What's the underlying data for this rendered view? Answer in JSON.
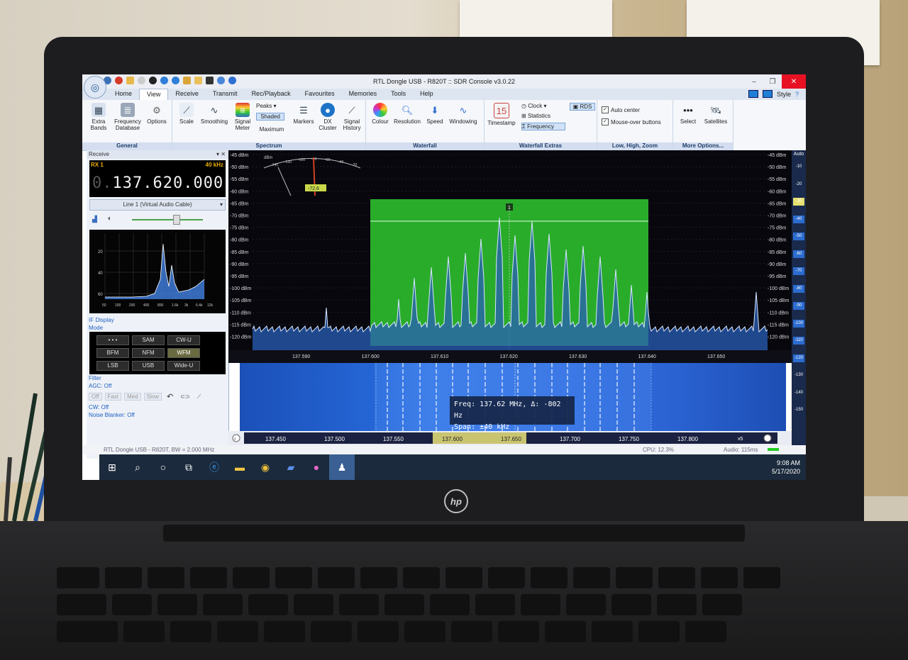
{
  "window": {
    "title": "RTL Dongle USB - R820T :: SDR Console v3.0.22",
    "min": "–",
    "max": "❐",
    "close": "✕"
  },
  "tabs": [
    "Home",
    "View",
    "Receive",
    "Transmit",
    "Rec/Playback",
    "Favourites",
    "Memories",
    "Tools",
    "Help"
  ],
  "active_tab": "View",
  "style_label": "Style",
  "ribbon": {
    "general": {
      "label": "General",
      "extra_bands": "Extra Bands",
      "frequency_database": "Frequency Database",
      "options": "Options"
    },
    "spectrum": {
      "label": "Spectrum",
      "scale": "Scale",
      "smoothing": "Smoothing",
      "signal_meter": "Signal Meter",
      "peaks": "Peaks",
      "shaded": "Shaded",
      "maximum": "Maximum",
      "markers": "Markers",
      "dx_cluster": "DX Cluster",
      "signal_history": "Signal History"
    },
    "waterfall": {
      "label": "Waterfall",
      "colour": "Colour",
      "resolution": "Resolution",
      "speed": "Speed",
      "windowing": "Windowing"
    },
    "waterfall_extras": {
      "label": "Waterfall Extras",
      "timestamp": "Timestamp",
      "clock": "Clock",
      "statistics": "Statistics",
      "frequency": "Frequency",
      "rds": "RDS"
    },
    "lhz": {
      "label": "Low, High, Zoom",
      "auto_center": "Auto center",
      "mouseover": "Mouse-over buttons"
    },
    "more": {
      "label": "More Options...",
      "select": "Select",
      "satellites": "Satellites"
    }
  },
  "receive": {
    "panel_title": "Receive",
    "rx_label": "RX 1",
    "bandwidth": "40 kHz",
    "freq_dim": "0.",
    "freq": "137.620.000",
    "audio_line": "Line 1 (Virtual Audio Cable)",
    "miniplot_yticks": [
      "20",
      "40",
      "60"
    ],
    "miniplot_xticks": [
      "50",
      "100",
      "200",
      "400",
      "800",
      "1.6k",
      "3k",
      "6.4k",
      "12k"
    ],
    "if_display": "IF Display",
    "mode": "Mode",
    "modes": [
      "• • •",
      "SAM",
      "CW-U",
      "BFM",
      "NFM",
      "WFM",
      "LSB",
      "USB",
      "Wide-U"
    ],
    "active_mode": "WFM",
    "filter": "Filter",
    "agc": "AGC: Off",
    "agc_buttons": [
      "Off",
      "Fast",
      "Med",
      "Slow"
    ],
    "cw": "CW: Off",
    "noise_blanker": "Noise Blanker: Off"
  },
  "spectrum": {
    "dbm_left": [
      "-45 dBm",
      "-50 dBm",
      "-55 dBm",
      "-60 dBm",
      "-65 dBm",
      "-70 dBm",
      "-75 dBm",
      "-80 dBm",
      "-85 dBm",
      "-90 dBm",
      "-95 dBm",
      "-100 dBm",
      "-105 dBm",
      "-110 dBm",
      "-115 dBm",
      "-120 dBm"
    ],
    "dbm_right": [
      "-45 dBm",
      "-50 dBm",
      "-55 dBm",
      "-60 dBm",
      "-65 dBm",
      "-70 dBm",
      "-75 dBm",
      "-80 dBm",
      "-85 dBm",
      "-90 dBm",
      "-95 dBm",
      "-100 dBm",
      "-105 dBm",
      "-110 dBm",
      "-115 dBm",
      "-120 dBm"
    ],
    "freq_ticks": [
      "137.590",
      "137.600",
      "137.610",
      "137.620",
      "137.630",
      "137.640",
      "137.650"
    ],
    "meter_unit": "dBm",
    "meter_scale": [
      "-140",
      "-120",
      "-100",
      "-80",
      "-60",
      "-40",
      "-20"
    ],
    "meter_value": "-72.6",
    "marker": "1"
  },
  "waterfall_ticks": [
    "137.450",
    "137.500",
    "137.550",
    "137.600",
    "137.650",
    "137.700",
    "137.750",
    "137.800"
  ],
  "tooltip": {
    "freq": "Freq: 137.62 MHz, Δ: -802 Hz",
    "span": "Span:    ±40 kHz"
  },
  "zoom_label": "x5",
  "rightbar": {
    "auto": "Auto",
    "levels": [
      "-10",
      "-20",
      "-30",
      "-40",
      "-50",
      "-60",
      "-70",
      "-80",
      "-90",
      "-100",
      "-110",
      "-120",
      "-130",
      "-140",
      "-150"
    ],
    "active": "-30"
  },
  "status": {
    "device": "RTL Dongle USB - R820T, BW = 2.000 MHz",
    "cpu": "CPU: 12.3%",
    "audio": "Audio: 115ms"
  },
  "taskbar": {
    "time": "9:08 AM",
    "date": "5/17/2020"
  },
  "colors": {
    "spectrum_bg": "#07070d",
    "passband": "#2fbf2f",
    "trace": "#d7e6ff",
    "waterfall": "#2566d6",
    "title_bar": "#ebeef4"
  }
}
